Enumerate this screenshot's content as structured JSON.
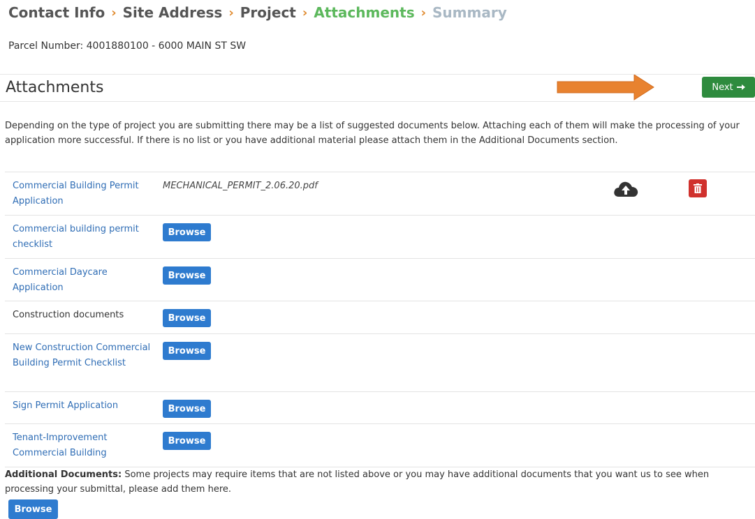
{
  "wizard": {
    "steps": [
      {
        "label": "Contact Info",
        "state": "done"
      },
      {
        "label": "Site Address",
        "state": "done"
      },
      {
        "label": "Project",
        "state": "done"
      },
      {
        "label": "Attachments",
        "state": "active"
      },
      {
        "label": "Summary",
        "state": "future"
      }
    ],
    "separator": "›"
  },
  "parcel": "Parcel Number: 4001880100 - 6000 MAIN ST SW",
  "section": {
    "title": "Attachments",
    "next_label": "Next",
    "next_icon": "arrow-right-icon",
    "pointer_arrow_color": "#e8822f"
  },
  "intro": "Depending on the type of project you are submitting there may be a list of suggested documents below. Attaching each of them will make the processing of your application more successful. If there is no list or you have additional material please attach them in the Additional Documents section.",
  "documents": [
    {
      "name": "Commercial Building Permit Application",
      "file": "MECHANICAL_PERMIT_2.06.20.pdf"
    },
    {
      "name": "Commercial building permit checklist",
      "browse": "Browse"
    },
    {
      "name": "Commercial Daycare Application",
      "browse": "Browse"
    },
    {
      "name": "Construction documents",
      "browse": "Browse"
    },
    {
      "name": "New Construction Commercial Building Permit Checklist",
      "browse": "Browse"
    },
    {
      "name": "Sign Permit Application",
      "browse": "Browse"
    },
    {
      "name": "Tenant-Improvement Commercial Building",
      "browse": "Browse"
    }
  ],
  "additional": {
    "label": "Additional Documents:",
    "text": " Some projects may require items that are not listed above or you may have additional documents that you want us to see when processing your submittal, please add them here.",
    "browse": "Browse"
  },
  "colors": {
    "active_step": "#5cb85c",
    "future_step": "#a9b8c4",
    "separator": "#e08a2e",
    "link": "#2f6db5",
    "browse_button": "#2e7bcf",
    "next_button": "#2e8b3e",
    "delete_button": "#d0312d"
  }
}
